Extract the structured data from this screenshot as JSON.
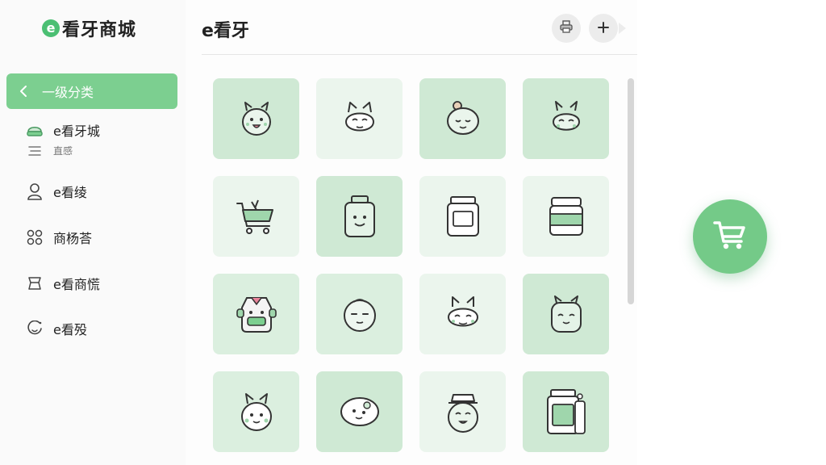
{
  "brand": {
    "logo_letter": "e",
    "name": "看牙商城"
  },
  "sidebar": {
    "category_label": "一级分类",
    "items": [
      {
        "label": "e看牙城",
        "icon": "dental-hat-icon"
      },
      {
        "label": "e看绫",
        "icon": "user-icon"
      },
      {
        "label": "商杨荅",
        "icon": "grid-icon"
      },
      {
        "label": "e看商慌",
        "icon": "box-icon"
      },
      {
        "label": "e看殁",
        "icon": "smile-icon"
      }
    ],
    "sub_item": {
      "label": "直感",
      "icon": "list-icon"
    }
  },
  "main": {
    "title": "e看牙",
    "header_buttons": [
      {
        "icon": "printer-icon"
      },
      {
        "icon": "plus-icon"
      }
    ],
    "tiles": [
      {
        "icon": "bunny-face-icon",
        "shade": "dark"
      },
      {
        "icon": "cat-face-icon",
        "shade": "light"
      },
      {
        "icon": "baby-face-icon",
        "shade": "dark"
      },
      {
        "icon": "bunny-smile-icon",
        "shade": "dark"
      },
      {
        "icon": "shopping-cart-icon",
        "shade": "light"
      },
      {
        "icon": "smiling-jar-icon",
        "shade": "dark"
      },
      {
        "icon": "jar-icon",
        "shade": "light"
      },
      {
        "icon": "green-jar-icon",
        "shade": "light"
      },
      {
        "icon": "robot-face-icon",
        "shade": "mid"
      },
      {
        "icon": "round-face-icon",
        "shade": "mid"
      },
      {
        "icon": "cat-smile-icon",
        "shade": "light"
      },
      {
        "icon": "monster-face-icon",
        "shade": "dark"
      },
      {
        "icon": "bunny-blush-icon",
        "shade": "mid"
      },
      {
        "icon": "spotted-face-icon",
        "shade": "dark"
      },
      {
        "icon": "hat-face-icon",
        "shade": "light"
      },
      {
        "icon": "jar-stack-icon",
        "shade": "dark"
      }
    ]
  },
  "fab": {
    "icon": "shopping-cart-icon"
  },
  "colors": {
    "accent": "#7ccf90",
    "accent_dark": "#4bbf73",
    "tile_dark": "#cfe9d4",
    "tile_mid": "#dbefdf",
    "tile_light": "#ebf5ed"
  }
}
